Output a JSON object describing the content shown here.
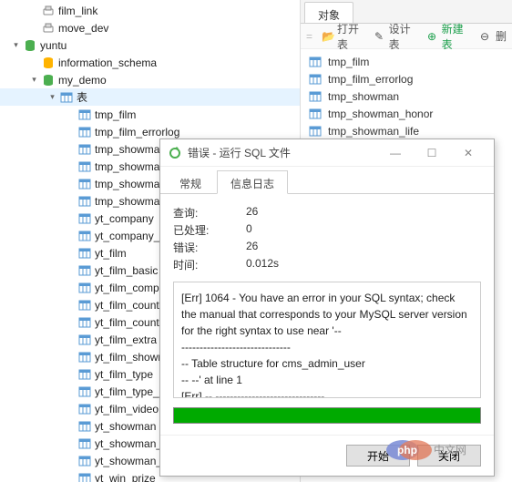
{
  "tree": {
    "nodes": [
      {
        "indent": 28,
        "exp": "",
        "icon": "link",
        "label": "film_link"
      },
      {
        "indent": 28,
        "exp": "",
        "icon": "link",
        "label": "move_dev"
      },
      {
        "indent": 8,
        "exp": "▾",
        "icon": "db",
        "label": "yuntu",
        "color": "#4caf50"
      },
      {
        "indent": 28,
        "exp": "",
        "icon": "db",
        "label": "information_schema",
        "color": "#ffb300"
      },
      {
        "indent": 28,
        "exp": "▾",
        "icon": "db",
        "label": "my_demo",
        "color": "#4caf50"
      },
      {
        "indent": 48,
        "exp": "▾",
        "icon": "table",
        "label": "表",
        "sel": true
      },
      {
        "indent": 68,
        "exp": "",
        "icon": "table",
        "label": "tmp_film"
      },
      {
        "indent": 68,
        "exp": "",
        "icon": "table",
        "label": "tmp_film_errorlog"
      },
      {
        "indent": 68,
        "exp": "",
        "icon": "table",
        "label": "tmp_showman"
      },
      {
        "indent": 68,
        "exp": "",
        "icon": "table",
        "label": "tmp_showman_honor"
      },
      {
        "indent": 68,
        "exp": "",
        "icon": "table",
        "label": "tmp_showman_life"
      },
      {
        "indent": 68,
        "exp": "",
        "icon": "table",
        "label": "tmp_showman_work"
      },
      {
        "indent": 68,
        "exp": "",
        "icon": "table",
        "label": "yt_company"
      },
      {
        "indent": 68,
        "exp": "",
        "icon": "table",
        "label": "yt_company_film"
      },
      {
        "indent": 68,
        "exp": "",
        "icon": "table",
        "label": "yt_film"
      },
      {
        "indent": 68,
        "exp": "",
        "icon": "table",
        "label": "yt_film_basic"
      },
      {
        "indent": 68,
        "exp": "",
        "icon": "table",
        "label": "yt_film_company"
      },
      {
        "indent": 68,
        "exp": "",
        "icon": "table",
        "label": "yt_film_country"
      },
      {
        "indent": 68,
        "exp": "",
        "icon": "table",
        "label": "yt_film_country_link"
      },
      {
        "indent": 68,
        "exp": "",
        "icon": "table",
        "label": "yt_film_extra"
      },
      {
        "indent": 68,
        "exp": "",
        "icon": "table",
        "label": "yt_film_showman"
      },
      {
        "indent": 68,
        "exp": "",
        "icon": "table",
        "label": "yt_film_type"
      },
      {
        "indent": 68,
        "exp": "",
        "icon": "table",
        "label": "yt_film_type_link"
      },
      {
        "indent": 68,
        "exp": "",
        "icon": "table",
        "label": "yt_film_video"
      },
      {
        "indent": 68,
        "exp": "",
        "icon": "table",
        "label": "yt_showman"
      },
      {
        "indent": 68,
        "exp": "",
        "icon": "table",
        "label": "yt_showman_prize"
      },
      {
        "indent": 68,
        "exp": "",
        "icon": "table",
        "label": "yt_showman_work"
      },
      {
        "indent": 68,
        "exp": "",
        "icon": "table",
        "label": "yt_win_prize"
      }
    ]
  },
  "right": {
    "tab": "对象",
    "toolbar": {
      "open": "打开表",
      "design": "设计表",
      "new": "新建表",
      "del": "删"
    },
    "items": [
      "tmp_film",
      "tmp_film_errorlog",
      "tmp_showman",
      "tmp_showman_honor",
      "tmp_showman_life"
    ]
  },
  "dialog": {
    "title": "错误 - 运行 SQL 文件",
    "tabs": {
      "general": "常规",
      "log": "信息日志"
    },
    "stats": {
      "q_label": "查询:",
      "q_val": "26",
      "p_label": "已处理:",
      "p_val": "0",
      "e_label": "错误:",
      "e_val": "26",
      "t_label": "时间:",
      "t_val": "0.012s"
    },
    "error_lines": [
      "[Err] 1064 - You have an error in your SQL syntax; check the manual that corresponds to your MySQL server version for the right syntax to use near '--",
      " ------------------------------",
      "-- Table structure for cms_admin_user",
      "-- --' at line 1",
      "[Err] -- ------------------------------"
    ],
    "buttons": {
      "start": "开始",
      "close": "关闭"
    }
  },
  "watermark": "php中文网"
}
